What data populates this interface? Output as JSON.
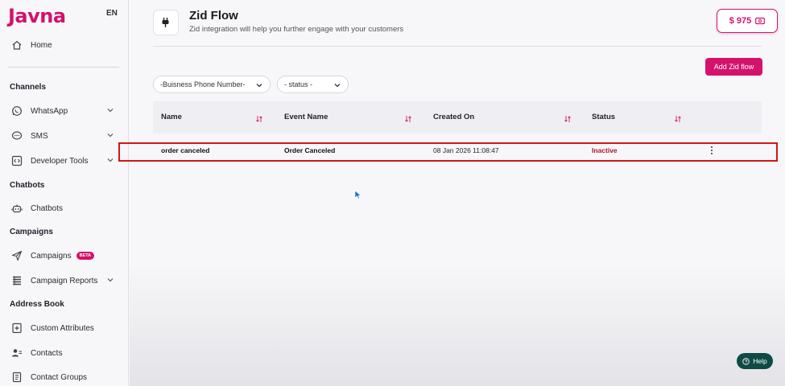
{
  "app": {
    "logo": "Javna",
    "lang": "EN"
  },
  "sidebar": {
    "home": "Home",
    "sections": {
      "channels": "Channels",
      "chatbots": "Chatbots",
      "campaigns": "Campaigns",
      "address_book": "Address Book"
    },
    "items": {
      "whatsapp": "WhatsApp",
      "sms": "SMS",
      "developer_tools": "Developer Tools",
      "chatbots": "Chatbots",
      "campaigns": "Campaigns",
      "campaigns_badge": "BETA",
      "campaign_reports": "Campaign Reports",
      "custom_attributes": "Custom Attributes",
      "contacts": "Contacts",
      "contact_groups": "Contact Groups"
    }
  },
  "header": {
    "title": "Zid Flow",
    "subtitle": "Zid integration will help you further engage with your customers",
    "balance": "$ 975"
  },
  "toolbar": {
    "add_label": "Add Zid flow",
    "phone_filter": "-Buisness Phone Number-",
    "status_filter": "- status -"
  },
  "table": {
    "columns": [
      "Name",
      "Event Name",
      "Created On",
      "Status"
    ],
    "rows": [
      {
        "name": "order canceled",
        "event": "Order Canceled",
        "created": "08 Jan 2026 11:08:47",
        "status": "Inactive"
      }
    ]
  },
  "help": {
    "label": "Help"
  },
  "colors": {
    "accent": "#d4126b",
    "status_inactive": "#b0122a",
    "help_bg": "#0f4a45",
    "highlight": "#d11616"
  }
}
